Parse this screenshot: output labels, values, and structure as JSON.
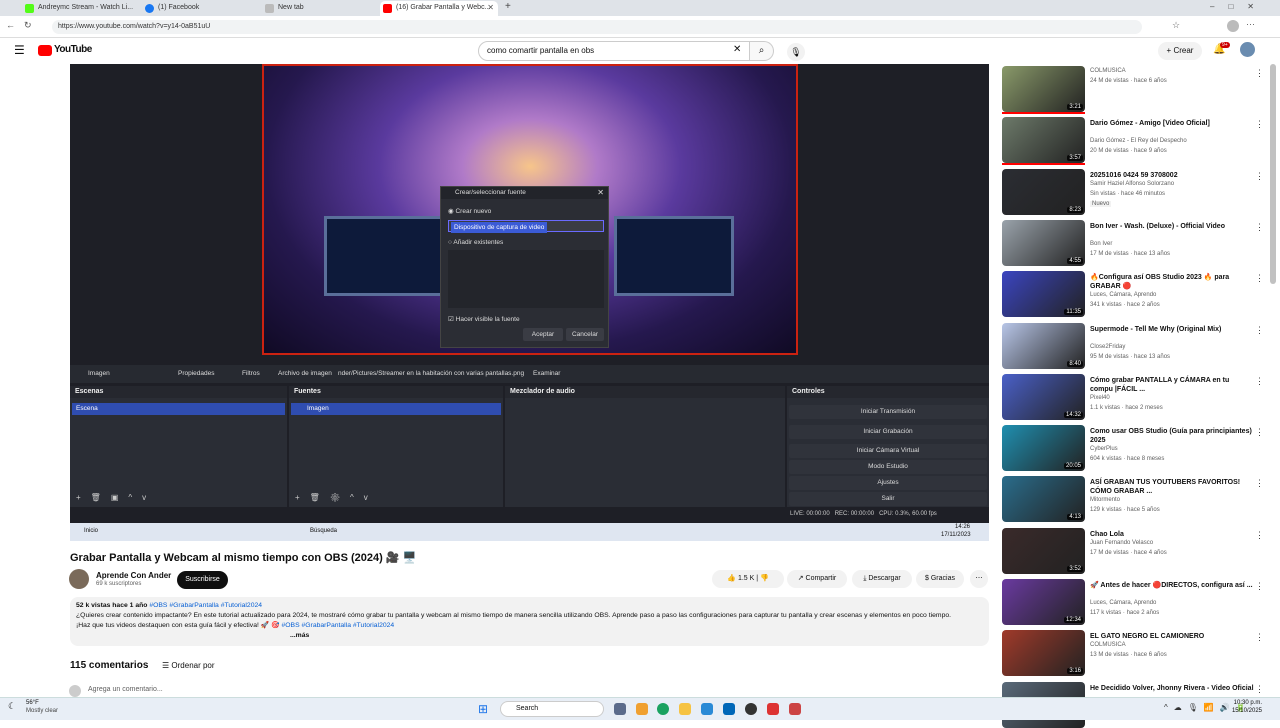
{
  "tabs": [
    {
      "label": "Andreymc Stream - Watch Li...",
      "color": "#53fc18"
    },
    {
      "label": "(1) Facebook",
      "color": "#1877f2"
    },
    {
      "label": "New tab",
      "color": "#999999"
    },
    {
      "label": "(16) Grabar Pantalla y Webc...",
      "color": "#ff0000"
    }
  ],
  "url": "https://www.youtube.com/watch?v=y14-0aB51uU",
  "youtube": {
    "logo": "YouTube",
    "search_value": "como comartir pantalla en obs",
    "create_label": "Crear",
    "notif_count": "9+"
  },
  "obs": {
    "dialog_title": "Crear/seleccionar fuente",
    "radio_new": "Crear nuevo",
    "input_value": "Dispositivo de captura de video",
    "radio_existing": "Añadir existentes",
    "visible_check": "Hacer visible la fuente",
    "accept": "Aceptar",
    "cancel": "Cancelar",
    "bar": {
      "source": "Imagen",
      "props": "Propiedades",
      "filters": "Filtros",
      "file_label": "Archivo de imagen",
      "file_path": "nder/Pictures/Streamer en la habitación con varias pantallas.png",
      "browse": "Examinar"
    },
    "docks": {
      "scenes": "Escenas",
      "scene_item": "Escena",
      "sources": "Fuentes",
      "source_item": "Imagen",
      "mixer": "Mezclador de audio",
      "controls": "Controles"
    },
    "controls": [
      "Iniciar Transmisión",
      "Iniciar Grabación",
      "Iniciar Cámara Virtual",
      "Modo Estudio",
      "Ajustes",
      "Salir"
    ],
    "status": {
      "live": "LIVE: 00:00:00",
      "rec": "REC: 00:00:00",
      "cpu": "CPU: 0.3%, 60.00 fps"
    },
    "inner_taskbar": {
      "start": "Inicio",
      "search": "Búsqueda",
      "time": "14:26",
      "date": "17/11/2023"
    }
  },
  "video": {
    "title": "Grabar Pantalla y Webcam al mismo tiempo con OBS (2024) 🎥 🖥️",
    "channel": "Aprende Con Ander",
    "subs": "69 k suscriptores",
    "subscribe": "Suscribirse",
    "likes": "1.5 K",
    "share": "Compartir",
    "download": "Descargar",
    "thanks": "Gracias",
    "views_line": "52 k vistas  hace 1 año",
    "tags": "#OBS #GrabarPantalla #Tutorial2024",
    "desc1": "¿Quieres crear contenido impactante? En este tutorial actualizado para 2024, te mostraré cómo grabar tu pantalla y webcam al mismo tiempo de manera sencilla utilizando OBS. Aprende paso a paso las configuraciones para capturar tu pantalla y crear escenas y elementos en poco tiempo.",
    "desc2": "¡Haz que tus videos destaquen con esta guía fácil y efectiva! 🚀 🎯",
    "desc2_tags": "#OBS #GrabarPantalla #Tutorial2024",
    "more": "...más",
    "comments": "115 comentarios",
    "sort": "Ordenar por",
    "add_comment": "Agrega un comentario..."
  },
  "recommendations": [
    {
      "title": "",
      "channel": "COLMUSICA",
      "meta": "24 M de vistas · hace 6 años",
      "duration": "3:21",
      "color": "#8a9a6a"
    },
    {
      "title": "Dario Gómez - Amigo [Video Oficial]",
      "channel": "Dario Gómez - El Rey del Despecho",
      "meta": "20 M de vistas · hace 9 años",
      "duration": "3:57",
      "color": "#6d7a6a"
    },
    {
      "title": "20251016 0424 59 3708002",
      "channel": "Samir Haziel Alfonso Solorzano",
      "meta": "Sin vistas · hace 46 minutos",
      "badge": "Nuevo",
      "duration": "8:23",
      "color": "#2b2d33"
    },
    {
      "title": "Bon Iver - Wash. (Deluxe) - Official Video",
      "channel": "Bon Iver",
      "meta": "17 M de vistas · hace 13 años",
      "duration": "4:55",
      "color": "#9aa3ab"
    },
    {
      "title": "🔥Configura así OBS Studio 2023 🔥 para GRABAR 🔴",
      "channel": "Luces, Cámara, Aprendo",
      "meta": "341 k vistas · hace 2 años",
      "duration": "11:35",
      "color": "#3b45c0"
    },
    {
      "title": "Supermode - Tell Me Why (Original Mix)",
      "channel": "Close2Friday",
      "meta": "95 M de vistas · hace 13 años",
      "duration": "8:40",
      "color": "#b8c6e8"
    },
    {
      "title": "Cómo grabar PANTALLA y CÁMARA en tu compu |FÁCIL ...",
      "channel": "Pixel40",
      "meta": "1.1 k vistas · hace 2 meses",
      "duration": "14:32",
      "color": "#4a60c8"
    },
    {
      "title": "Como usar OBS Studio (Guía para principiantes) 2025",
      "channel": "CyberPlus",
      "meta": "604 k vistas · hace 8 meses",
      "duration": "20:05",
      "color": "#1f8fb0"
    },
    {
      "title": "ASÍ GRABAN TUS YOUTUBERS FAVORITOS! CÓMO GRABAR ...",
      "channel": "Mitormento",
      "meta": "129 k vistas · hace 5 años",
      "duration": "4:13",
      "color": "#2a6d8c"
    },
    {
      "title": "Chao Lola",
      "channel": "Juan Fernando Velasco",
      "meta": "17 M de vistas · hace 4 años",
      "duration": "3:52",
      "color": "#3a2a2a"
    },
    {
      "title": "🚀 Antes de hacer 🔴DIRECTOS, configura así ...",
      "channel": "Luces, Cámara, Aprendo",
      "meta": "117 k vistas · hace 2 años",
      "duration": "12:34",
      "color": "#6a3aa0"
    },
    {
      "title": "EL GATO NEGRO EL CAMIONERO",
      "channel": "COLMUSICA",
      "meta": "13 M de vistas · hace 6 años",
      "duration": "3:16",
      "color": "#a03a2a"
    },
    {
      "title": "He Decidido Volver, Jhonny Rivera - Video Oficial",
      "channel": "",
      "meta": "",
      "duration": "",
      "color": "#5a6a7a"
    }
  ],
  "win_taskbar": {
    "weather_temp": "56°F",
    "weather_desc": "Mostly clear",
    "search": "Search",
    "time": "10:30 p.m.",
    "date": "15/10/2025"
  },
  "colors": {
    "yt_red": "#ff0000",
    "obs_blue": "#2f4db0"
  }
}
